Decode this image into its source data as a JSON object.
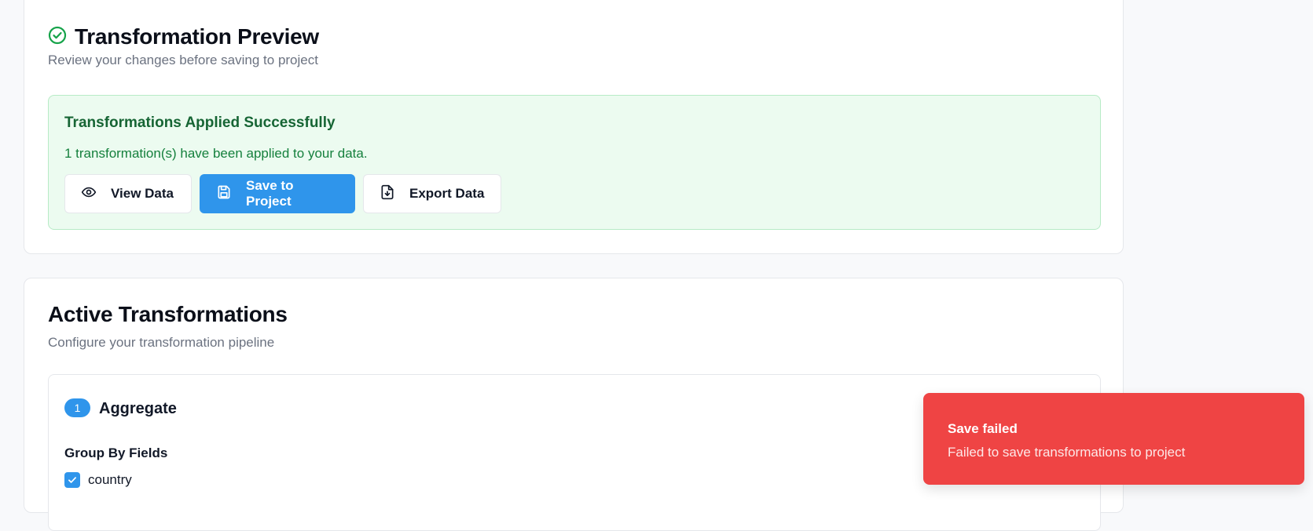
{
  "preview": {
    "title": "Transformation Preview",
    "subtitle": "Review your changes before saving to project",
    "success": {
      "title": "Transformations Applied Successfully",
      "message": "1 transformation(s) have been applied to your data."
    },
    "buttons": {
      "view": "View Data",
      "save": "Save to Project",
      "export": "Export Data"
    }
  },
  "active": {
    "title": "Active Transformations",
    "subtitle": "Configure your transformation pipeline",
    "step": {
      "number": "1",
      "name": "Aggregate",
      "group_label": "Group By Fields",
      "fields": [
        {
          "label": "country",
          "checked": true
        }
      ]
    }
  },
  "toast": {
    "title": "Save failed",
    "message": "Failed to save transformations to project"
  },
  "colors": {
    "accent": "#2f95eb",
    "success_bg": "#ecfbf0",
    "success_text": "#166534",
    "error": "#ef4444"
  },
  "icons": {
    "title": "check-circle-icon",
    "view": "eye-icon",
    "save": "save-icon",
    "export": "file-download-icon",
    "checkbox": "check-icon"
  }
}
